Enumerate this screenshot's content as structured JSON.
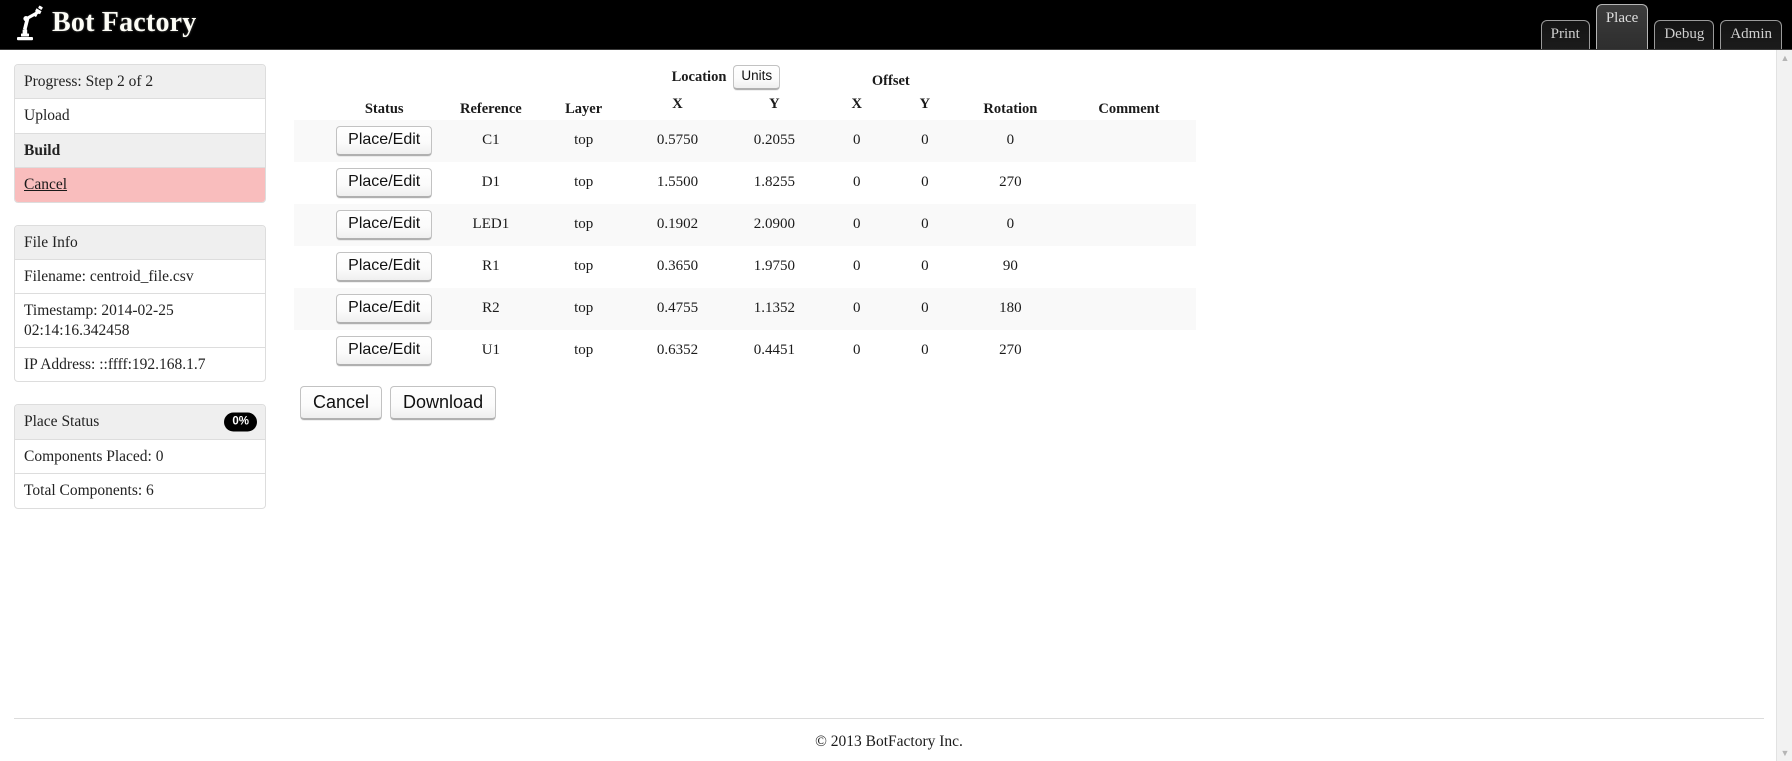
{
  "app": {
    "brand": "Bot Factory",
    "brand_icon": "robot-arm-icon"
  },
  "nav": {
    "tabs": [
      {
        "label": "Print",
        "active": false
      },
      {
        "label": "Place",
        "active": true
      },
      {
        "label": "Debug",
        "active": false
      },
      {
        "label": "Admin",
        "active": false
      }
    ]
  },
  "sidebar": {
    "progress": {
      "title": "Progress: Step 2 of 2",
      "steps": [
        {
          "label": "Upload",
          "state": "done"
        },
        {
          "label": "Build",
          "state": "current"
        },
        {
          "label": "Cancel",
          "state": "cancel"
        }
      ]
    },
    "file_info": {
      "title": "File Info",
      "filename": "Filename: centroid_file.csv",
      "timestamp": "Timestamp: 2014-02-25 02:14:16.342458",
      "ip_address": "IP Address: ::ffff:192.168.1.7"
    },
    "place_status": {
      "title": "Place Status",
      "badge": "0%",
      "components_placed": "Components Placed: 0",
      "total_components": "Total Components: 6"
    }
  },
  "table": {
    "headers": {
      "spacer": "",
      "status": "Status",
      "reference": "Reference",
      "layer": "Layer",
      "location": "Location",
      "units_button": "Units",
      "offset": "Offset",
      "rotation": "Rotation",
      "comment": "Comment",
      "location_x": "X",
      "location_y": "Y",
      "offset_x": "X",
      "offset_y": "Y"
    },
    "row_button_label": "Place/Edit",
    "rows": [
      {
        "reference": "C1",
        "layer": "top",
        "loc_x": "0.5750",
        "loc_y": "0.2055",
        "off_x": "0",
        "off_y": "0",
        "rotation": "0",
        "comment": ""
      },
      {
        "reference": "D1",
        "layer": "top",
        "loc_x": "1.5500",
        "loc_y": "1.8255",
        "off_x": "0",
        "off_y": "0",
        "rotation": "270",
        "comment": ""
      },
      {
        "reference": "LED1",
        "layer": "top",
        "loc_x": "0.1902",
        "loc_y": "2.0900",
        "off_x": "0",
        "off_y": "0",
        "rotation": "0",
        "comment": ""
      },
      {
        "reference": "R1",
        "layer": "top",
        "loc_x": "0.3650",
        "loc_y": "1.9750",
        "off_x": "0",
        "off_y": "0",
        "rotation": "90",
        "comment": ""
      },
      {
        "reference": "R2",
        "layer": "top",
        "loc_x": "0.4755",
        "loc_y": "1.1352",
        "off_x": "0",
        "off_y": "0",
        "rotation": "180",
        "comment": ""
      },
      {
        "reference": "U1",
        "layer": "top",
        "loc_x": "0.6352",
        "loc_y": "0.4451",
        "off_x": "0",
        "off_y": "0",
        "rotation": "270",
        "comment": ""
      }
    ]
  },
  "actions": {
    "cancel": "Cancel",
    "download": "Download"
  },
  "footer": {
    "copyright": "© 2013 BotFactory Inc."
  },
  "colors": {
    "topbar_bg": "#000000",
    "cancel_row_bg": "#f9bdbd",
    "panel_head_bg": "#efefef",
    "badge_bg": "#000000",
    "row_stripe": "#f9f9f9"
  }
}
